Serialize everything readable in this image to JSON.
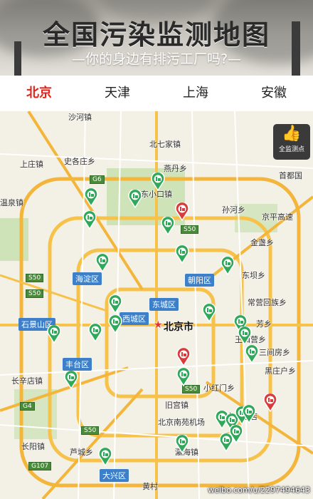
{
  "header": {
    "title": "全国污染监测地图",
    "subtitle": "—你的身边有排污工厂吗?—"
  },
  "tabs": [
    {
      "label": "北京",
      "active": true
    },
    {
      "label": "天津",
      "active": false
    },
    {
      "label": "上海",
      "active": false
    },
    {
      "label": "安徽",
      "active": false
    }
  ],
  "badge": {
    "icon": "thumbs-up-icon",
    "label": "全监测点"
  },
  "map": {
    "city_center": "北京市",
    "places": [
      "沙河镇",
      "北七家镇",
      "史各庄乡",
      "上庄镇",
      "燕丹乡",
      "东小口镇",
      "首都国",
      "温泉镇",
      "孙河乡",
      "京平高速",
      "金盏乡",
      "东坝乡",
      "常营回族乡",
      "芳乡",
      "王四营乡",
      "三间房乡",
      "黑庄户乡",
      "长辛店镇",
      "旧宫镇",
      "北京南苑机场",
      "长阳镇",
      "芦城乡",
      "黄村",
      "瀛海镇",
      "小红门乡",
      "十八里店",
      "北京市"
    ],
    "district_tags": [
      "海淀区",
      "朝阳区",
      "东城区",
      "西城区",
      "石景山区",
      "丰台区",
      "大兴区"
    ],
    "highway_tags": [
      "G6",
      "S50",
      "S50",
      "S50",
      "S50",
      "G4",
      "S50",
      "G107"
    ]
  },
  "watermark": "weibo.com/u/2297494643"
}
